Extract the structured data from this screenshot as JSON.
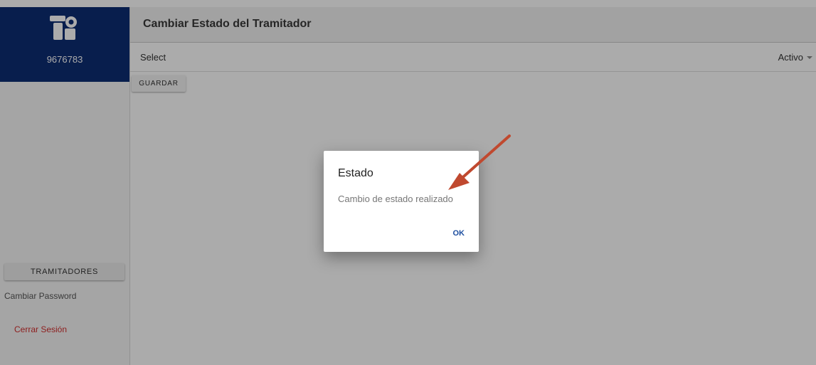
{
  "sidebar": {
    "user_id": "9676783",
    "nav_button": "TRAMITADORES",
    "change_password": "Cambiar Password",
    "logout": "Cerrar Sesión"
  },
  "header": {
    "title": "Cambiar Estado del Tramitador"
  },
  "form": {
    "select_label": "Select",
    "select_value": "Activo",
    "save_button": "GUARDAR"
  },
  "dialog": {
    "title": "Estado",
    "message": "Cambio de estado realizado",
    "ok_button": "OK"
  },
  "colors": {
    "brand": "#0d2d74",
    "logout": "#d32f2f",
    "ok_button": "#1e4fa0",
    "annotation_arrow": "#c0492f"
  },
  "icons": {
    "logo": "logo-icon",
    "select_caret": "caret-down-icon",
    "annotation": "arrow-annotation"
  }
}
